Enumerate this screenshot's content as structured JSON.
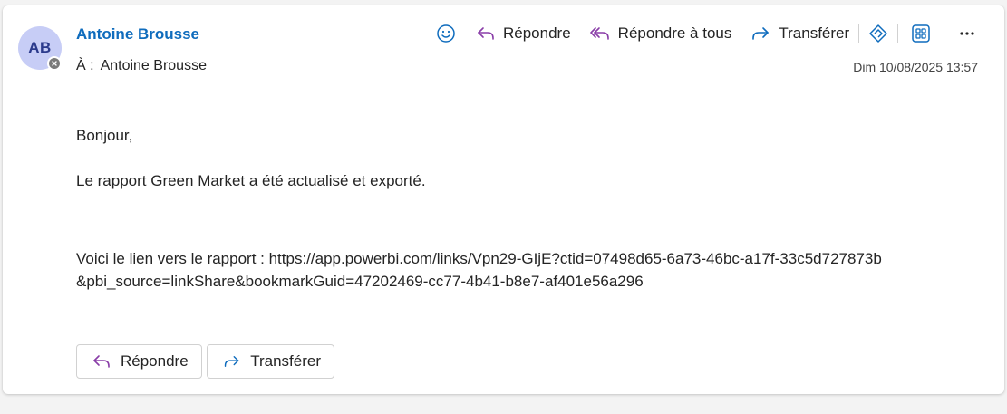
{
  "sender": {
    "initials": "AB",
    "name": "Antoine Brousse"
  },
  "recipient": {
    "prefix": "À :",
    "name": "Antoine Brousse"
  },
  "timestamp": "Dim 10/08/2025 13:57",
  "toolbar": {
    "emoji_icon": "emoji-icon",
    "reply_label": "Répondre",
    "reply_all_label": "Répondre à tous",
    "forward_label": "Transférer",
    "more_icon": "more-icon"
  },
  "message": {
    "greeting": "Bonjour,",
    "line1": "Le rapport Green Market a été actualisé et exporté.",
    "link_line": "Voici le lien vers le rapport : https://app.powerbi.com/links/Vpn29-GIjE?ctid=07498d65-6a73-46bc-a17f-33c5d727873b&pbi_source=linkShare&bookmarkGuid=47202469-cc77-4b41-b8e7-af401e56a296"
  },
  "actions": {
    "reply_label": "Répondre",
    "forward_label": "Transférer"
  },
  "colors": {
    "accent": "#0f6cbd",
    "reply_icon": "#8a3ea8",
    "forward_icon": "#0f6cbd",
    "avatar_bg": "#c7cdf6"
  }
}
